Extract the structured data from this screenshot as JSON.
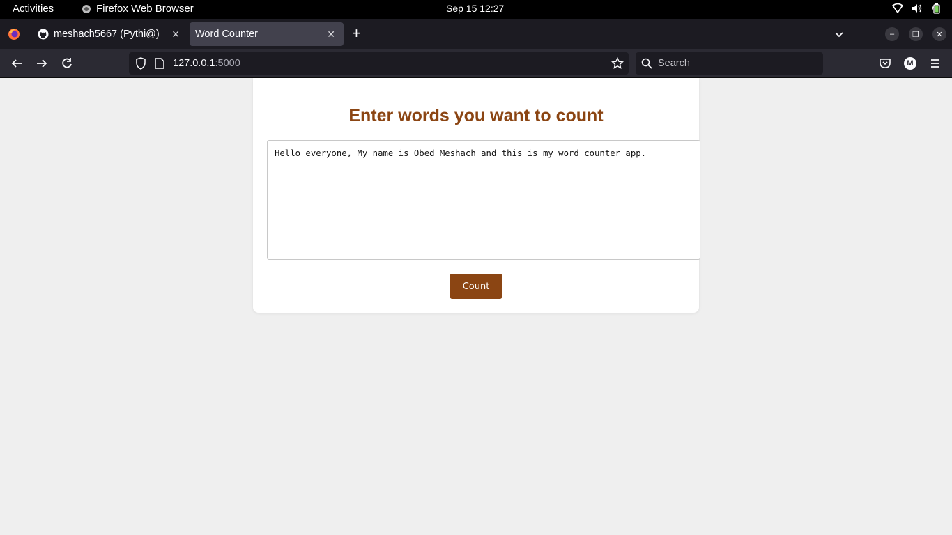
{
  "system": {
    "activities": "Activities",
    "app_name": "Firefox Web Browser",
    "clock": "Sep 15  12:27"
  },
  "browser": {
    "tabs": [
      {
        "title": "meshach5667 (Pythi@)",
        "favicon": "github-icon",
        "active": false
      },
      {
        "title": "Word Counter",
        "favicon": "none",
        "active": true
      }
    ],
    "url_host": "127.0.0.1",
    "url_port": ":5000",
    "search_placeholder": "Search",
    "account_initial": "M"
  },
  "page": {
    "heading": "Enter words you want to count",
    "textarea_value": "Hello everyone, My name is Obed Meshach and this is my word counter app.",
    "count_button": "Count"
  },
  "colors": {
    "accent": "#8b4513",
    "page_bg": "#efefef",
    "card_bg": "#ffffff"
  }
}
